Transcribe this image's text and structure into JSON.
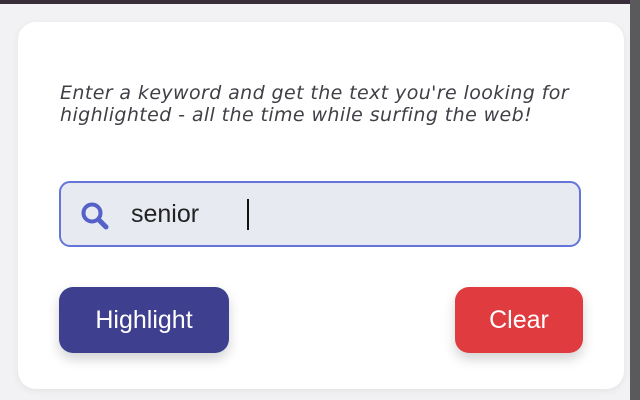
{
  "description": "Enter a keyword and get the text you're looking for highlighted - all the time while surfing the web!",
  "search": {
    "value": "senior",
    "icon": "search-icon"
  },
  "buttons": {
    "highlight_label": "Highlight",
    "clear_label": "Clear"
  },
  "colors": {
    "highlight_button": "#3e3f8e",
    "clear_button": "#e03c40",
    "input_border": "#6474d8",
    "input_background": "#e7eaf0"
  }
}
